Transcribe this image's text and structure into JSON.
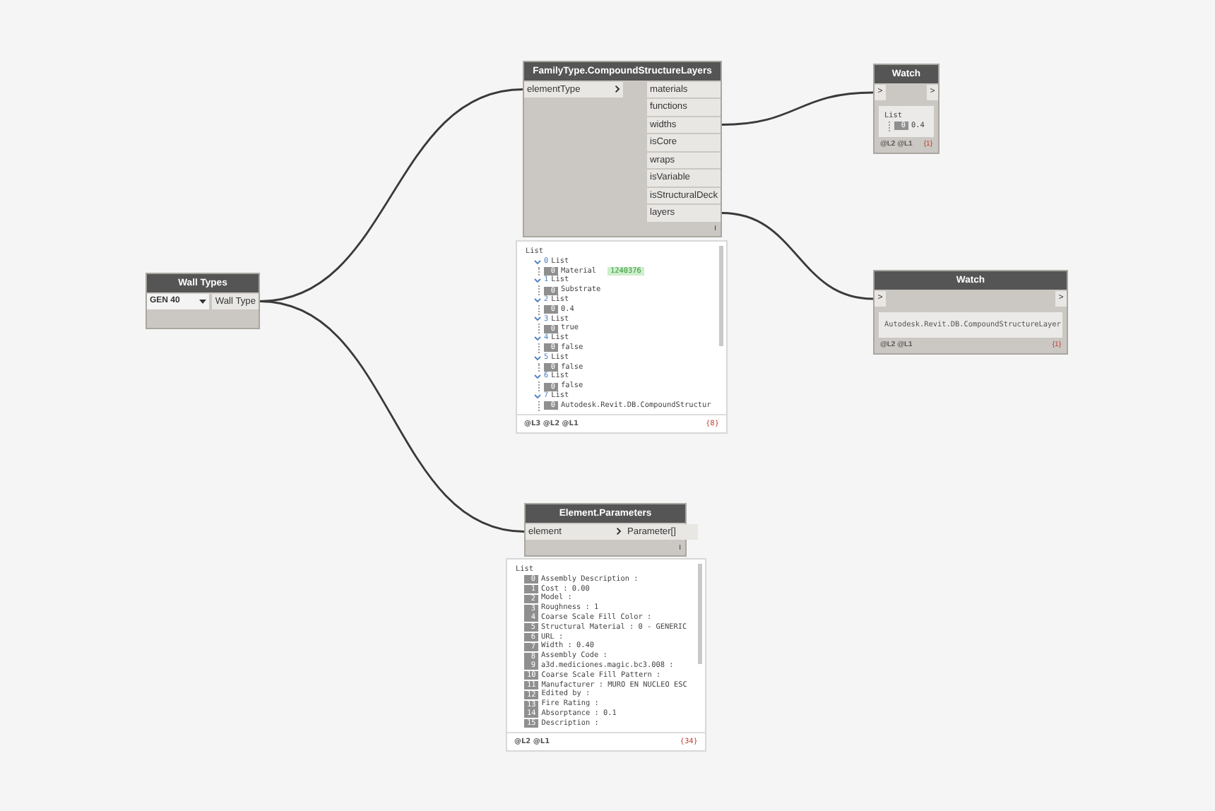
{
  "nodes": [
    {
      "kind": "dropdown",
      "title": "Wall Types",
      "value": "GEN 40",
      "outputs": [
        "Wall Type"
      ]
    },
    {
      "kind": "function",
      "title": "FamilyType.CompoundStructureLayers",
      "inputs": [
        "elementType"
      ],
      "outputs": [
        "materials",
        "functions",
        "widths",
        "isCore",
        "wraps",
        "isVariable",
        "isStructuralDeck",
        "layers"
      ],
      "lacing": "I",
      "preview": {
        "label": "List",
        "levels": "@L3 @L2 @L1",
        "count": "{8}",
        "items": [
          {
            "index": "0",
            "label": "List",
            "children": [
              {
                "index": "0",
                "label": "Material",
                "tag": "1240376"
              }
            ]
          },
          {
            "index": "1",
            "label": "List",
            "children": [
              {
                "index": "0",
                "label": "Substrate"
              }
            ]
          },
          {
            "index": "2",
            "label": "List",
            "children": [
              {
                "index": "0",
                "label": "0.4"
              }
            ]
          },
          {
            "index": "3",
            "label": "List",
            "children": [
              {
                "index": "0",
                "label": "true"
              }
            ]
          },
          {
            "index": "4",
            "label": "List",
            "children": [
              {
                "index": "0",
                "label": "false"
              }
            ]
          },
          {
            "index": "5",
            "label": "List",
            "children": [
              {
                "index": "0",
                "label": "false"
              }
            ]
          },
          {
            "index": "6",
            "label": "List",
            "children": [
              {
                "index": "0",
                "label": "false"
              }
            ]
          },
          {
            "index": "7",
            "label": "List",
            "children": [
              {
                "index": "0",
                "label": "Autodesk.Revit.DB.CompoundStructur"
              }
            ]
          }
        ]
      }
    },
    {
      "kind": "function",
      "title": "Element.Parameters",
      "inputs": [
        "element"
      ],
      "outputs": [
        "Parameter[]"
      ],
      "lacing": "I",
      "preview": {
        "label": "List",
        "levels": "@L2 @L1",
        "count": "{34}",
        "items": [
          {
            "index": "0",
            "label": "Assembly Description :"
          },
          {
            "index": "1",
            "label": "Cost : 0.00"
          },
          {
            "index": "2",
            "label": "Model :"
          },
          {
            "index": "3",
            "label": "Roughness : 1"
          },
          {
            "index": "4",
            "label": "Coarse Scale Fill Color :"
          },
          {
            "index": "5",
            "label": "Structural Material : 0 - GENERIC"
          },
          {
            "index": "6",
            "label": "URL :"
          },
          {
            "index": "7",
            "label": "Width : 0.40"
          },
          {
            "index": "8",
            "label": "Assembly Code :"
          },
          {
            "index": "9",
            "label": "a3d.mediciones.magic.bc3.008 :"
          },
          {
            "index": "10",
            "label": "Coarse Scale Fill Pattern :"
          },
          {
            "index": "11",
            "label": "Manufacturer : MURO EN NUCLEO ESC"
          },
          {
            "index": "12",
            "label": "Edited by :"
          },
          {
            "index": "13",
            "label": "Fire Rating :"
          },
          {
            "index": "14",
            "label": "Absorptance : 0.1"
          },
          {
            "index": "15",
            "label": "Description :"
          }
        ]
      }
    },
    {
      "kind": "watch",
      "title": "Watch",
      "inputs": [
        ">"
      ],
      "outputs": [
        ">"
      ],
      "display": {
        "label": "List",
        "items": [
          {
            "index": "0",
            "label": "0.4"
          }
        ]
      },
      "levels": "@L2 @L1",
      "count": "{1}"
    },
    {
      "kind": "watch",
      "title": "Watch",
      "inputs": [
        ">"
      ],
      "outputs": [
        ">"
      ],
      "display": {
        "text": "Autodesk.Revit.DB.CompoundStructureLayer"
      },
      "levels": "@L2 @L1",
      "count": "{1}"
    }
  ]
}
